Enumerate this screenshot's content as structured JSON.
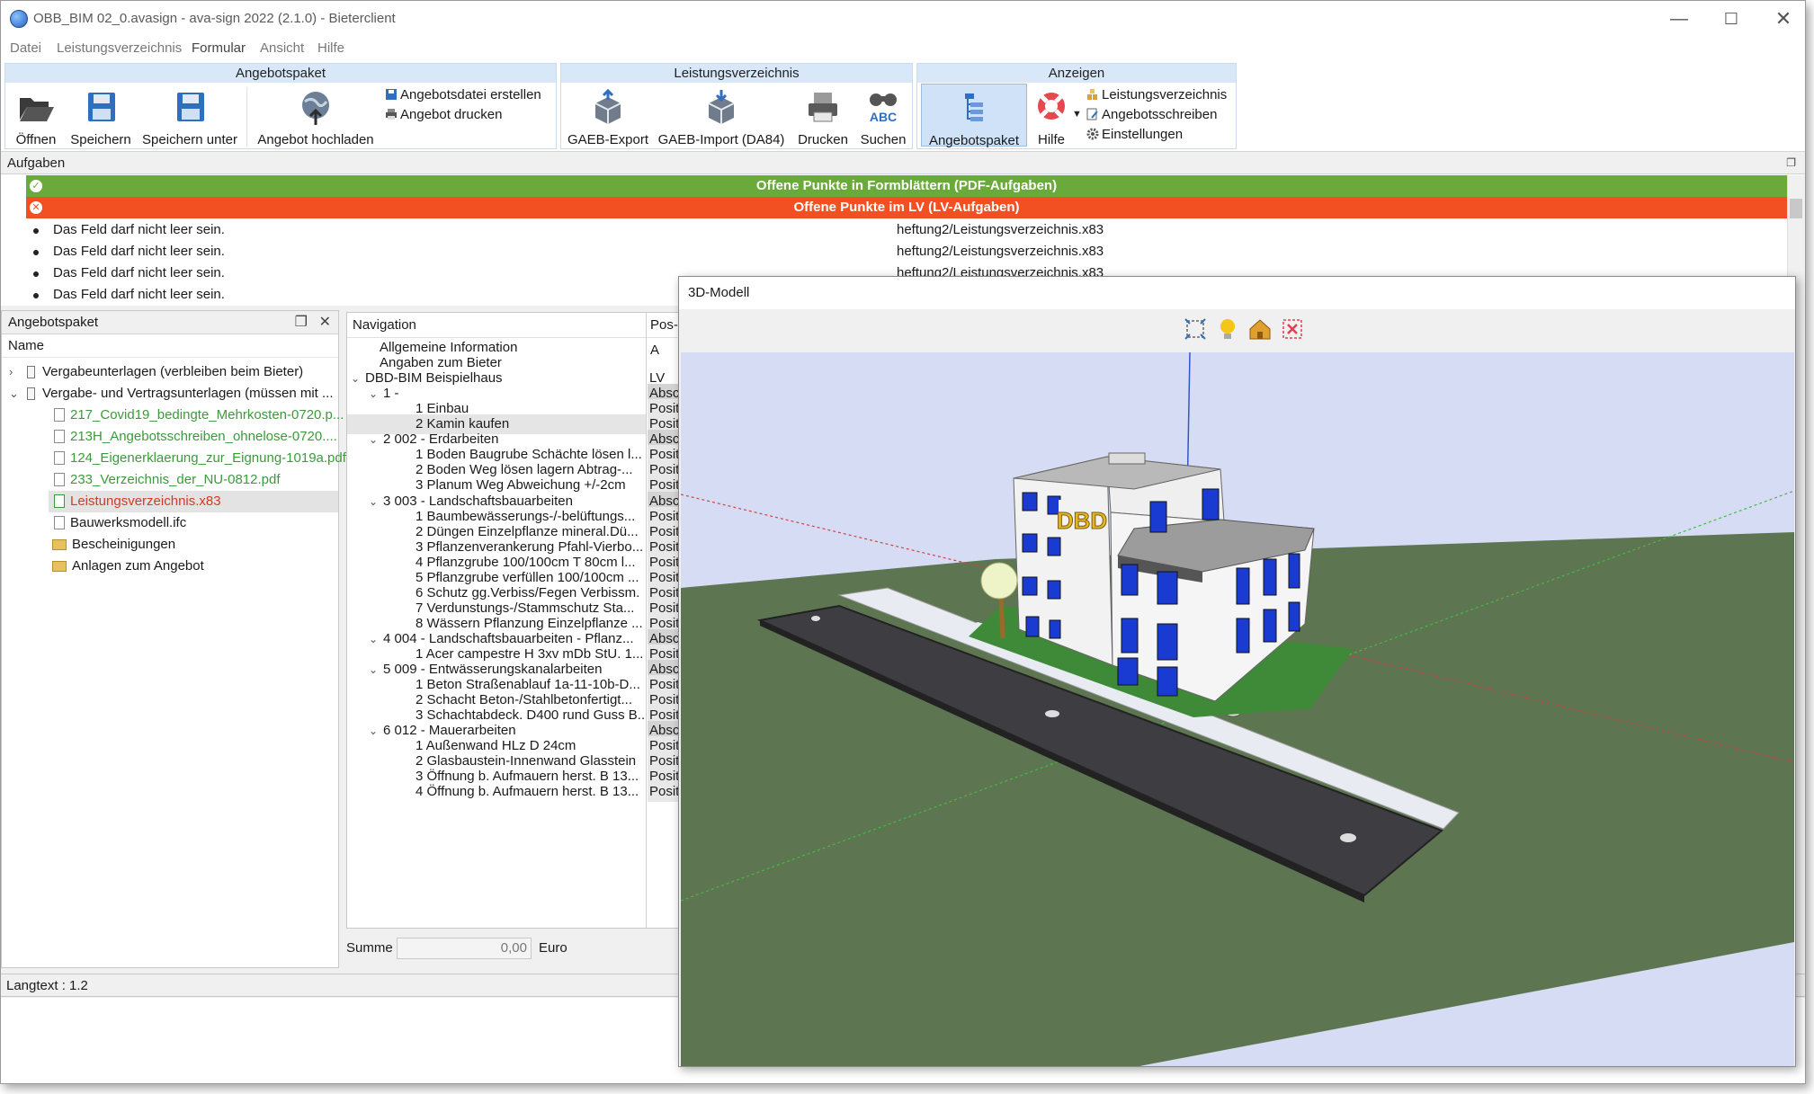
{
  "window": {
    "title": "OBB_BIM 02_0.avasign - ava-sign 2022 (2.1.0) - Bieterclient"
  },
  "menu": [
    "Datei",
    "Leistungsverzeichnis",
    "Formular",
    "Ansicht",
    "Hilfe"
  ],
  "ribbon": {
    "groups": {
      "angebotspaket": "Angebotspaket",
      "lv": "Leistungsverzeichnis",
      "anzeigen": "Anzeigen"
    },
    "buttons": {
      "oeffnen": "Öffnen",
      "speichern": "Speichern",
      "speichern_unter": "Speichern unter",
      "angebot_hochladen": "Angebot hochladen",
      "angebotsdatei_erstellen": "Angebotsdatei erstellen",
      "angebot_drucken": "Angebot drucken",
      "gaeb_export": "GAEB-Export",
      "gaeb_import": "GAEB-Import (DA84)",
      "drucken": "Drucken",
      "suchen": "Suchen",
      "angebotspaket": "Angebotspaket",
      "hilfe": "Hilfe",
      "leistungsverzeichnis": "Leistungsverzeichnis",
      "angebotsschreiben": "Angebotsschreiben",
      "einstellungen": "Einstellungen"
    },
    "colors": {
      "group_header": "#d8e8f8",
      "active": "#cfe2f7"
    }
  },
  "tasks": {
    "title": "Aufgaben",
    "bar_pdf": "Offene Punkte in Formblättern (PDF-Aufgaben)",
    "bar_lv": "Offene Punkte im LV (LV-Aufgaben)",
    "colors": {
      "pdf": "#6aaa3a",
      "lv": "#f25022"
    },
    "rows": [
      {
        "msg": "Das Feld darf nicht leer sein.",
        "src": "heftung2/Leistungsverzeichnis.x83"
      },
      {
        "msg": "Das Feld darf nicht leer sein.",
        "src": "heftung2/Leistungsverzeichnis.x83"
      },
      {
        "msg": "Das Feld darf nicht leer sein.",
        "src": "heftung2/Leistungsverzeichnis.x83"
      },
      {
        "msg": "Das Feld darf nicht leer sein.",
        "src": ""
      }
    ]
  },
  "paket": {
    "title": "Angebotspaket",
    "col_name": "Name",
    "items": [
      "Vergabeunterlagen (verbleiben beim Bieter)",
      "Vergabe- und Vertragsunterlagen (müssen mit ...",
      "217_Covid19_bedingte_Mehrkosten-0720.p...",
      "213H_Angebotsschreiben_ohnelose-0720....",
      "124_Eigenerklaerung_zur_Eignung-1019a.pdf",
      "233_Verzeichnis_der_NU-0812.pdf",
      "Leistungsverzeichnis.x83",
      "Bauwerksmodell.ifc",
      "Bescheinigungen",
      "Anlagen zum Angebot"
    ]
  },
  "navigation": {
    "title": "Navigation",
    "col2": "Pos-A",
    "rows": [
      {
        "t": "Allgemeine Information",
        "c": ""
      },
      {
        "t": "Angaben zum Bieter",
        "c": ""
      },
      {
        "t": "DBD-BIM Beispielhaus",
        "c": "LV"
      },
      {
        "t": "1 -",
        "c": "Abschn"
      },
      {
        "t": "1 Einbau",
        "c": "Position"
      },
      {
        "t": "2 Kamin kaufen",
        "c": "Position"
      },
      {
        "t": "2 002 - Erdarbeiten",
        "c": "Abschn"
      },
      {
        "t": "1 Boden Baugrube Schächte lösen l...",
        "c": "Position"
      },
      {
        "t": "2 Boden Weg lösen lagern Abtrag-...",
        "c": "Position"
      },
      {
        "t": "3 Planum Weg Abweichung +/-2cm",
        "c": "Position"
      },
      {
        "t": "3 003 - Landschaftsbauarbeiten",
        "c": "Abschn"
      },
      {
        "t": "1 Baumbewässerungs-/-belüftungs...",
        "c": "Position"
      },
      {
        "t": "2 Düngen Einzelpflanze mineral.Dü...",
        "c": "Position"
      },
      {
        "t": "3 Pflanzenverankerung Pfahl-Vierbo...",
        "c": "Position"
      },
      {
        "t": "4 Pflanzgrube 100/100cm T 80cm l...",
        "c": "Position"
      },
      {
        "t": "5 Pflanzgrube verfüllen 100/100cm ...",
        "c": "Position"
      },
      {
        "t": "6 Schutz gg.Verbiss/Fegen Verbissm.",
        "c": "Position"
      },
      {
        "t": "7 Verdunstungs-/Stammschutz Sta...",
        "c": "Position"
      },
      {
        "t": "8 Wässern Pflanzung Einzelpflanze ...",
        "c": "Position"
      },
      {
        "t": "4 004 - Landschaftsbauarbeiten - Pflanz...",
        "c": "Abschn"
      },
      {
        "t": "1 Acer campestre H 3xv mDb StU. 1...",
        "c": "Position"
      },
      {
        "t": "5 009 - Entwässerungskanalarbeiten",
        "c": "Abschn"
      },
      {
        "t": "1 Beton Straßenablauf 1a-11-10b-D...",
        "c": "Position"
      },
      {
        "t": "2 Schacht Beton-/Stahlbetonfertigt...",
        "c": "Position"
      },
      {
        "t": "3 Schachtabdeck. D400 rund Guss B...",
        "c": "Position"
      },
      {
        "t": "6 012 - Mauerarbeiten",
        "c": "Abschn"
      },
      {
        "t": "1 Außenwand HLz D 24cm",
        "c": "Position"
      },
      {
        "t": "2 Glasbaustein-Innenwand Glasstein",
        "c": "Position"
      },
      {
        "t": "3 Öffnung b. Aufmauern herst. B 13...",
        "c": "Position"
      },
      {
        "t": "4 Öffnung b. Aufmauern herst. B 13...",
        "c": "Position"
      }
    ]
  },
  "summe": {
    "label": "Summe",
    "value": "0,00",
    "currency": "Euro"
  },
  "status": {
    "langtext": "Langtext : 1.2"
  },
  "model": {
    "title": "3D-Modell",
    "sign": "DBD"
  }
}
